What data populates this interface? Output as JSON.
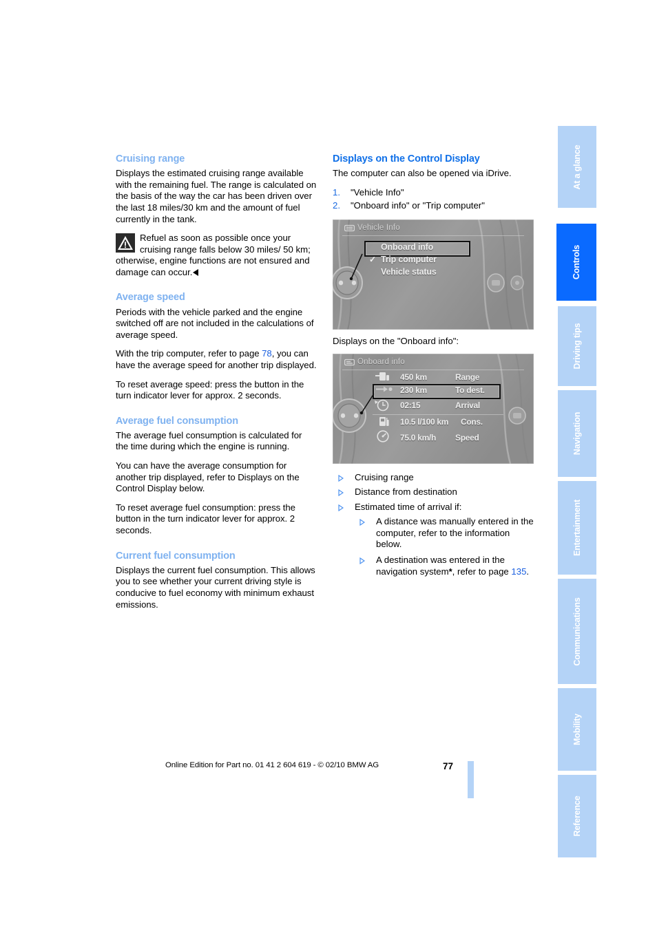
{
  "page": {
    "number": "77",
    "footer_legal": "Online Edition for Part no. 01 41 2 604 619 - © 02/10 BMW AG",
    "accent_light_blue": "#7fb2f0",
    "accent_blue": "#1070e8",
    "tab_inactive_bg": "#b4d3f7",
    "tab_active_bg": "#0a6aff"
  },
  "left_column": {
    "cruising_range": {
      "title": "Cruising range",
      "paragraph": "Displays the estimated cruising range available with the remaining fuel. The range is calculated on the basis of the way the car has been driven over the last 18 miles/30 km and the amount of fuel currently in the tank.",
      "warning": "Refuel as soon as possible once your cruising range falls below 30 miles/ 50 km; otherwise, engine functions are not ensured and damage can occur."
    },
    "average_speed": {
      "title": "Average speed",
      "paragraph_1": "Periods with the vehicle parked and the engine switched off are not included in the calculations of average speed.",
      "paragraph_2_before": "With the trip computer, refer to page ",
      "paragraph_2_link": "78",
      "paragraph_2_after": ", you can have the average speed for another trip displayed.",
      "paragraph_3": "To reset average speed: press the button in the turn indicator lever for approx. 2 seconds."
    },
    "average_fuel_consumption": {
      "title": "Average fuel consumption",
      "paragraph_1": "The average fuel consumption is calculated for the time during which the engine is running.",
      "paragraph_2": "You can have the average consumption for another trip displayed, refer to Displays on the Control Display below.",
      "paragraph_3": "To reset average fuel consumption: press the button in the turn indicator lever for approx. 2 seconds."
    },
    "current_fuel_consumption": {
      "title": "Current fuel consumption",
      "paragraph": "Displays the current fuel consumption. This allows you to see whether your current driving style is conducive to fuel economy with minimum exhaust emissions."
    }
  },
  "right_column": {
    "title": "Displays on the Control Display",
    "intro": "The computer can also be opened via iDrive.",
    "steps": [
      {
        "num": "1.",
        "text": "\"Vehicle Info\""
      },
      {
        "num": "2.",
        "text": "\"Onboard info\" or \"Trip computer\""
      }
    ],
    "screenshot_vehicle_info": {
      "title": "Vehicle Info",
      "items": [
        {
          "label": "Onboard info",
          "selected": true,
          "checked": false
        },
        {
          "label": "Trip computer",
          "selected": false,
          "checked": true
        },
        {
          "label": "Vehicle status",
          "selected": false,
          "checked": false
        }
      ]
    },
    "caption": "Displays on the \"Onboard info\":",
    "screenshot_onboard_info": {
      "title": "Onboard info",
      "rows": [
        {
          "icon": "fuel-range-icon",
          "value": "450 km",
          "label": "Range",
          "selected": false
        },
        {
          "icon": "distance-arrow-icon",
          "value": "230 km",
          "label": "To dest.",
          "selected": true
        },
        {
          "icon": "clock-arrival-icon",
          "value": "02:15",
          "label": "Arrival",
          "selected": false
        },
        {
          "icon": "fuel-pump-icon",
          "value": "10.5 l/100 km",
          "label": "Cons.",
          "selected": false
        },
        {
          "icon": "speedometer-icon",
          "value": "75.0 km/h",
          "label": "Speed",
          "selected": false
        }
      ]
    },
    "bullets": [
      {
        "text": "Cruising range",
        "children": []
      },
      {
        "text": "Distance from destination",
        "children": []
      },
      {
        "text": "Estimated time of arrival if:",
        "children": [
          {
            "text": "A distance was manually entered in the computer, refer to the information below."
          },
          {
            "text_before": "A destination was entered in the navigation system",
            "asterisk": "*",
            "text_mid": ", refer to page ",
            "link": "135",
            "text_after": "."
          }
        ]
      }
    ]
  },
  "rail_tabs": [
    {
      "label": "At a glance",
      "active": false
    },
    {
      "label": "Controls",
      "active": true
    },
    {
      "label": "Driving tips",
      "active": false
    },
    {
      "label": "Navigation",
      "active": false
    },
    {
      "label": "Entertainment",
      "active": false
    },
    {
      "label": "Communications",
      "active": false
    },
    {
      "label": "Mobility",
      "active": false
    },
    {
      "label": "Reference",
      "active": false
    }
  ]
}
